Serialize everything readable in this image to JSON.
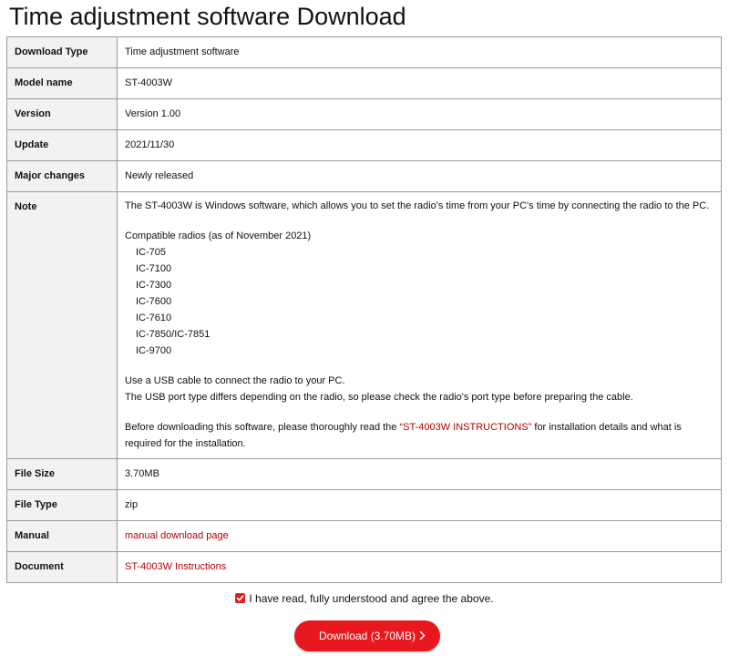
{
  "page": {
    "title": "Time adjustment software Download"
  },
  "rows": {
    "download_type": {
      "label": "Download Type",
      "value": "Time adjustment software"
    },
    "model_name": {
      "label": "Model name",
      "value": "ST-4003W"
    },
    "version": {
      "label": "Version",
      "value": "Version 1.00"
    },
    "update": {
      "label": "Update",
      "value": "2021/11/30"
    },
    "major_changes": {
      "label": "Major changes",
      "value": "Newly released"
    },
    "note": {
      "label": "Note",
      "intro": "The ST-4003W is Windows software, which allows you to set the radio's time from your PC's time by connecting the radio to the PC.",
      "compat_heading": "Compatible radios (as of November 2021)",
      "radios": [
        "IC-705",
        "IC-7100",
        "IC-7300",
        "IC-7600",
        "IC-7610",
        "IC-7850/IC-7851",
        "IC-9700"
      ],
      "usb_line1": "Use a USB cable to connect the radio to your PC.",
      "usb_line2": "The USB port type differs depending on the radio, so please check the radio's port type before preparing the cable.",
      "before_text": "Before downloading this software, please thoroughly read the ",
      "instructions_link": "“ST-4003W INSTRUCTIONS”",
      "after_text": " for installation details and what is required for the installation."
    },
    "file_size": {
      "label": "File Size",
      "value": "3.70MB"
    },
    "file_type": {
      "label": "File Type",
      "value": "zip"
    },
    "manual": {
      "label": "Manual",
      "link": "manual download page"
    },
    "document": {
      "label": "Document",
      "link": "ST-4003W Instructions"
    }
  },
  "agreement": {
    "checked": true,
    "label": "I have read, fully understood and agree the above."
  },
  "download_button": {
    "label": "Download (3.70MB)"
  },
  "colors": {
    "accent": "#e8181e",
    "link": "#b30000",
    "header_bg": "#f2f2f2",
    "border": "#9a9a9a"
  }
}
